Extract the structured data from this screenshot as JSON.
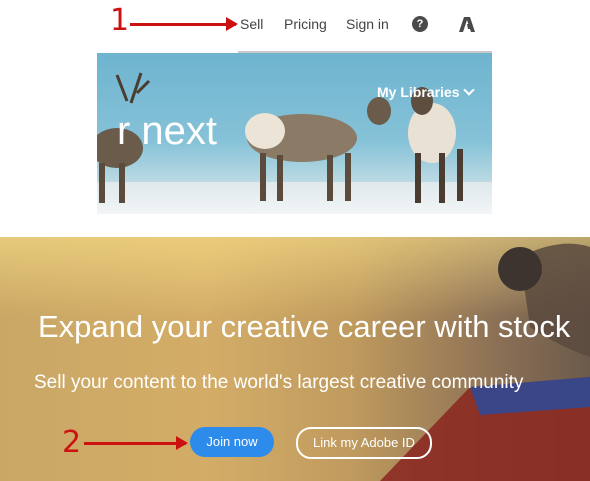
{
  "annotations": {
    "step_one": "1",
    "step_two": "2"
  },
  "nav": {
    "sell": "Sell",
    "pricing": "Pricing",
    "sign_in": "Sign in",
    "help_icon": "question-circle",
    "logo_icon": "adobe-logo"
  },
  "hero": {
    "text": "r next",
    "my_libraries": "My Libraries"
  },
  "banner": {
    "headline": "Expand your creative career with stock",
    "subheadline": "Sell your content to the world's largest creative community",
    "join_button": "Join now",
    "link_button": "Link my Adobe ID"
  },
  "colors": {
    "annotation_red": "#cc1111",
    "primary_button": "#2d8ceb",
    "nav_text": "#444444"
  }
}
